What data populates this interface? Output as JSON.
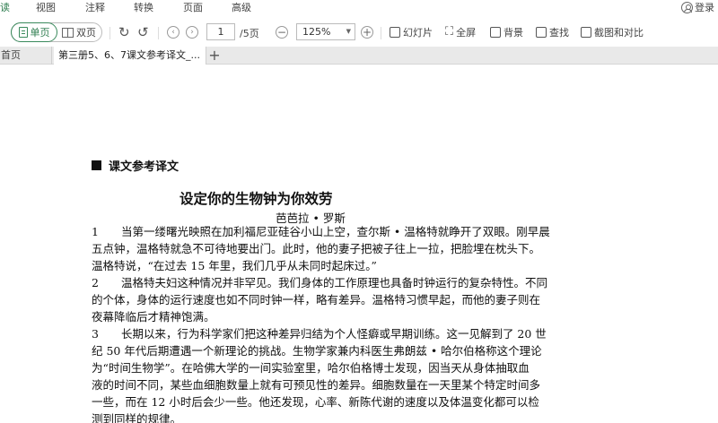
{
  "menu": {
    "items": [
      "读",
      "视图",
      "注释",
      "转换",
      "页面",
      "高级"
    ],
    "login": "登录"
  },
  "toolbar": {
    "single_page": "单页",
    "double_page": "双页",
    "current_page": "1",
    "total_pages": "/5页",
    "zoom": "125%",
    "slideshow": "幻灯片",
    "fullscreen": "全屏",
    "background": "背景",
    "find": "查找",
    "screenshot_compare": "截图和对比"
  },
  "tabs": {
    "home": "首页",
    "document": "第三册5、6、7课文参考译文_..."
  },
  "document": {
    "section_heading": "课文参考译文",
    "title": "设定你的生物钟为你效劳",
    "author": "芭芭拉 • 罗斯",
    "lines": [
      "1　　当第一缕曙光映照在加利福尼亚硅谷小山上空，查尔斯 • 温格特就睁开了双眼。刚早晨",
      "五点钟，温格特就急不可待地要出门。此时，他的妻子把被子往上一拉，把脸埋在枕头下。",
      "温格特说，“在过去 15 年里，我们几乎从未同时起床过。”",
      "2　　温格特夫妇这种情况并非罕见。我们身体的工作原理也具备时钟运行的复杂特性。不同",
      "的个体，身体的运行速度也如不同时钟一样，略有差异。温格特习惯早起，而他的妻子则在",
      "夜幕降临后才精神饱满。",
      "3　　长期以来，行为科学家们把这种差异归结为个人怪癖或早期训练。这一见解到了 20 世",
      "纪 50 年代后期遭遇一个新理论的挑战。生物学家兼内科医生弗朗兹 • 哈尔伯格称这个理论",
      "为“时间生物学”。在哈佛大学的一间实验室里，哈尔伯格博士发现，因当天从身体抽取血",
      "液的时间不同，某些血细胞数量上就有可预见性的差异。细胞数量在一天里某个特定时间多",
      "一些，而在 12 小时后会少一些。他还发现，心率、新陈代谢的速度以及体温变化都可以检",
      "测到同样的规律。"
    ]
  }
}
